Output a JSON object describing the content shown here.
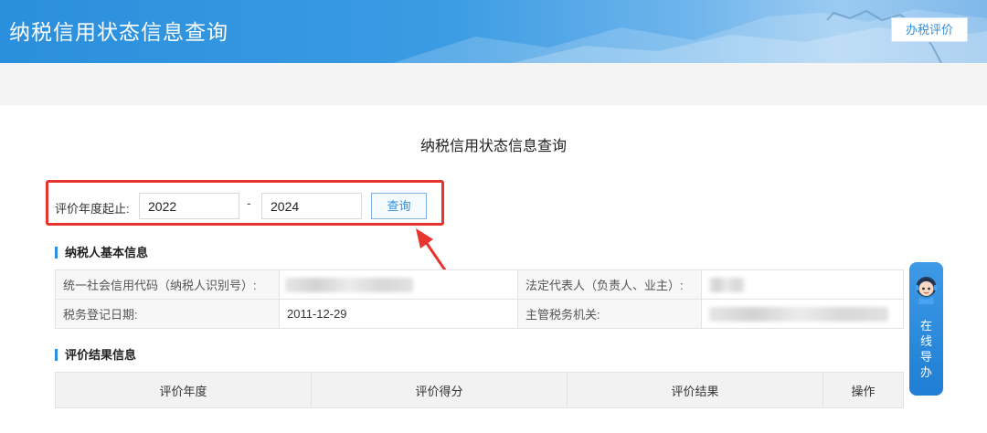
{
  "header": {
    "title": "纳税信用状态信息查询",
    "rate_button": "办税评价"
  },
  "page": {
    "title": "纳税信用状态信息查询"
  },
  "query": {
    "label": "评价年度起止:",
    "start_year": "2022",
    "separator": "-",
    "end_year": "2024",
    "button": "查询"
  },
  "basic_info": {
    "section_title": "纳税人基本信息",
    "credit_code_label": "统一社会信用代码（纳税人识别号）:",
    "legal_rep_label": "法定代表人（负责人、业主）:",
    "reg_date_label": "税务登记日期:",
    "reg_date_value": "2011-12-29",
    "tax_authority_label": "主管税务机关:"
  },
  "result_info": {
    "section_title": "评价结果信息",
    "columns": [
      "评价年度",
      "评价得分",
      "评价结果",
      "操作"
    ]
  },
  "guide": {
    "text": "在线导办"
  },
  "colors": {
    "accent": "#2c8fe0",
    "highlight": "#e8342f"
  }
}
